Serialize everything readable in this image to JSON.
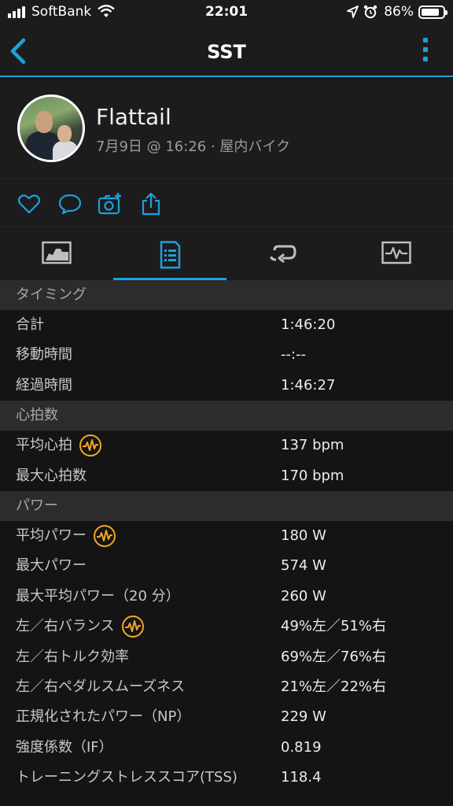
{
  "status_bar": {
    "carrier": "SoftBank",
    "time": "22:01",
    "battery_pct": "86%",
    "battery_level": 0.86
  },
  "nav": {
    "title": "SST"
  },
  "profile": {
    "name": "Flattail",
    "subtitle": "7月9日 @ 16:26 · 屋内バイク"
  },
  "colors": {
    "accent": "#1ea0db",
    "badge": "#f5a623"
  },
  "sections": [
    {
      "title": "タイミング",
      "rows": [
        {
          "label": "合計",
          "value": "1:46:20"
        },
        {
          "label": "移動時間",
          "value": "--:--"
        },
        {
          "label": "経過時間",
          "value": "1:46:27"
        }
      ]
    },
    {
      "title": "心拍数",
      "rows": [
        {
          "label": "平均心拍",
          "value": "137 bpm",
          "badge": true
        },
        {
          "label": "最大心拍数",
          "value": "170 bpm"
        }
      ]
    },
    {
      "title": "パワー",
      "rows": [
        {
          "label": "平均パワー",
          "value": "180 W",
          "badge": true
        },
        {
          "label": "最大パワー",
          "value": "574 W"
        },
        {
          "label": "最大平均パワー（20 分）",
          "value": "260 W"
        },
        {
          "label": "左／右バランス",
          "value": "49%左／51%右",
          "badge": true
        },
        {
          "label": "左／右トルク効率",
          "value": "69%左／76%右"
        },
        {
          "label": "左／右ペダルスムーズネス",
          "value": "21%左／22%右"
        },
        {
          "label": "正規化されたパワー（NP）",
          "value": "229 W"
        },
        {
          "label": "強度係数（IF）",
          "value": "0.819"
        },
        {
          "label": "トレーニングストレススコア(TSS)",
          "value": "118.4"
        }
      ]
    }
  ]
}
